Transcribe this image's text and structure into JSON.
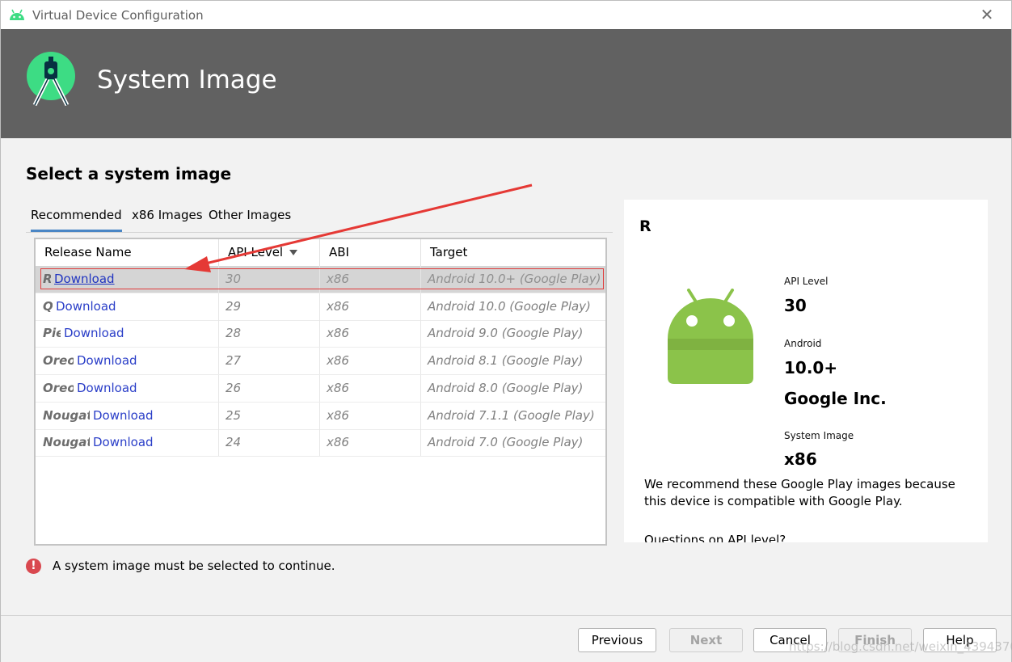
{
  "window": {
    "title": "Virtual Device Configuration",
    "close_glyph": "✕"
  },
  "banner": {
    "title": "System Image"
  },
  "page": {
    "heading": "Select a system image"
  },
  "tabs": [
    {
      "label": "Recommended",
      "active": true
    },
    {
      "label": "x86 Images",
      "active": false
    },
    {
      "label": "Other Images",
      "active": false
    }
  ],
  "table": {
    "columns": [
      "Release Name",
      "API Level",
      "ABI",
      "Target"
    ],
    "sorted_column": "API Level",
    "rows": [
      {
        "release": "R",
        "action": "Download",
        "api": "30",
        "abi": "x86",
        "target": "Android 10.0+ (Google Play)",
        "selected": true
      },
      {
        "release": "Q",
        "action": "Download",
        "api": "29",
        "abi": "x86",
        "target": "Android 10.0 (Google Play)",
        "selected": false
      },
      {
        "release": "Pie",
        "action": "Download",
        "api": "28",
        "abi": "x86",
        "target": "Android 9.0 (Google Play)",
        "selected": false
      },
      {
        "release": "Oreo",
        "action": "Download",
        "api": "27",
        "abi": "x86",
        "target": "Android 8.1 (Google Play)",
        "selected": false
      },
      {
        "release": "Oreo",
        "action": "Download",
        "api": "26",
        "abi": "x86",
        "target": "Android 8.0 (Google Play)",
        "selected": false
      },
      {
        "release": "Nougat",
        "action": "Download",
        "api": "25",
        "abi": "x86",
        "target": "Android 7.1.1 (Google Play)",
        "selected": false
      },
      {
        "release": "Nougat",
        "action": "Download",
        "api": "24",
        "abi": "x86",
        "target": "Android 7.0 (Google Play)",
        "selected": false
      }
    ]
  },
  "details": {
    "title": "R",
    "api_level_label": "API Level",
    "api_level_value": "30",
    "android_label": "Android",
    "android_value": "10.0+",
    "vendor": "Google Inc.",
    "system_image_label": "System Image",
    "system_image_value": "x86",
    "description": "We recommend these Google Play images because this device is compatible with Google Play.",
    "help_link": "Questions on API level?"
  },
  "error": {
    "icon": "!",
    "message": "A system image must be selected to continue."
  },
  "buttons": {
    "previous": "Previous",
    "next": "Next",
    "cancel": "Cancel",
    "finish": "Finish",
    "help": "Help"
  },
  "watermark": "https://blog.csdn.net/weixin_43943707",
  "colors": {
    "banner": "#616161",
    "android_green": "#8bc34a",
    "android_logo_green": "#3ddc84",
    "accent_tab": "#4a86c5",
    "link": "#2a3ec8",
    "error": "#d9484f",
    "annotation_red": "#e03b3b"
  }
}
